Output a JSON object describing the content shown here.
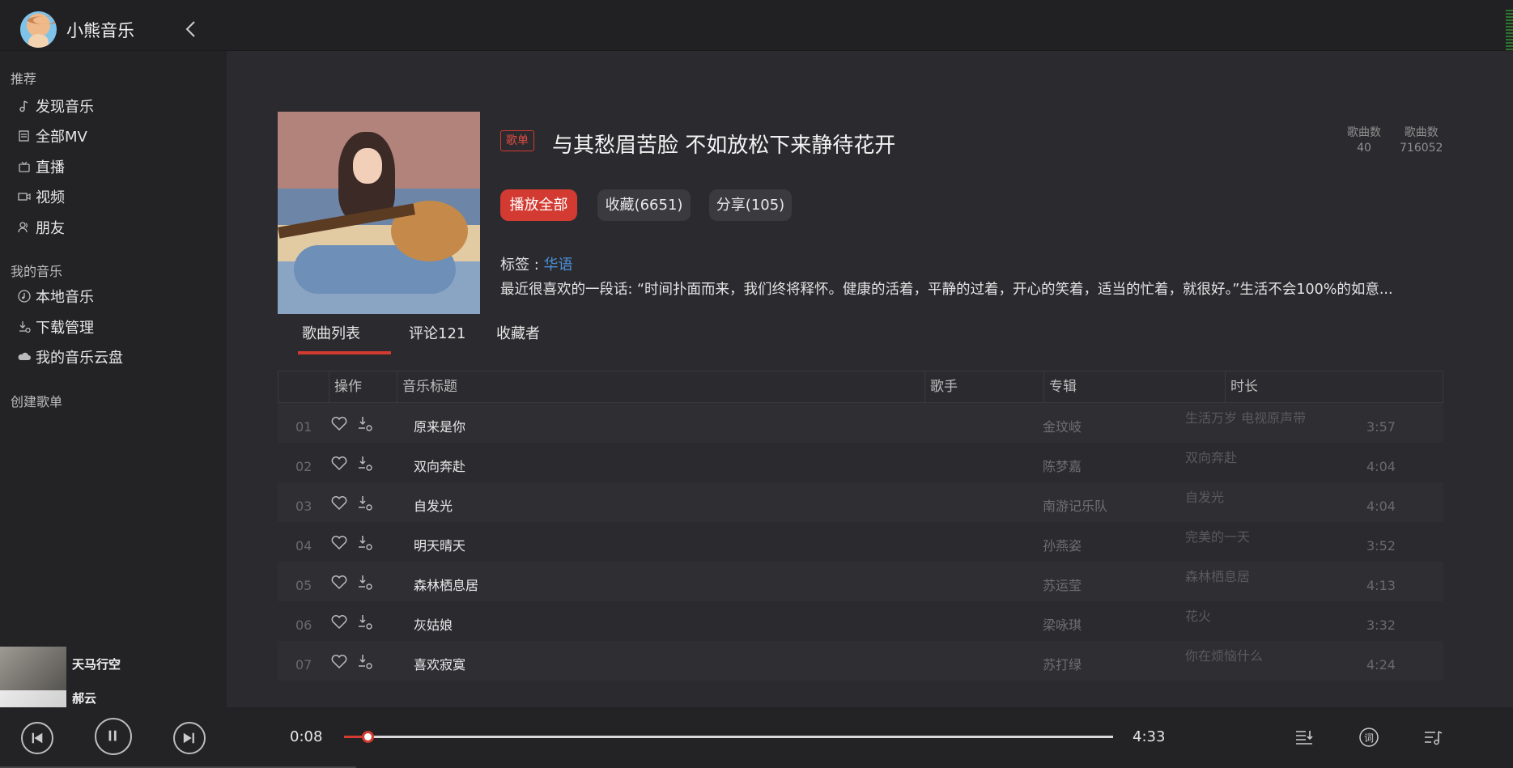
{
  "app": {
    "title": "小熊音乐"
  },
  "sidebar": {
    "section_recommend": "推荐",
    "recommend_items": [
      {
        "label": "发现音乐",
        "icon": "music-note-icon"
      },
      {
        "label": "全部MV",
        "icon": "mv-icon"
      },
      {
        "label": "直播",
        "icon": "live-icon"
      },
      {
        "label": "视频",
        "icon": "video-icon"
      },
      {
        "label": "朋友",
        "icon": "friends-icon"
      }
    ],
    "section_mine": "我的音乐",
    "mine_items": [
      {
        "label": "本地音乐",
        "icon": "local-music-icon"
      },
      {
        "label": "下载管理",
        "icon": "download-icon"
      },
      {
        "label": "我的音乐云盘",
        "icon": "cloud-icon"
      }
    ],
    "section_create": "创建歌单",
    "mini_playlist": [
      {
        "name": "天马行空"
      },
      {
        "name": "郝云"
      }
    ]
  },
  "playlist": {
    "badge": "歌单",
    "title": "与其愁眉苦脸 不如放松下来静待花开",
    "stats": [
      {
        "label": "歌曲数",
        "value": "40"
      },
      {
        "label": "歌曲数",
        "value": "716052"
      }
    ],
    "buttons": {
      "play_all": "播放全部",
      "collect": "收藏(6651)",
      "share": "分享(105)"
    },
    "tag_label": "标签 : ",
    "tag_value": "华语",
    "description": "最近很喜欢的一段话: “时间扑面而来，我们终将释怀。健康的活着，平静的过着，开心的笑着，适当的忙着，就很好。”生活不会100%的如意..."
  },
  "tabs": [
    "歌曲列表",
    "评论121",
    "收藏者"
  ],
  "table": {
    "headers": [
      "操作",
      "音乐标题",
      "歌手",
      "专辑",
      "时长"
    ],
    "rows": [
      {
        "no": "01",
        "title": "原来是你",
        "artist": "金玟岐",
        "album": "生活万岁 电视原声带",
        "duration": "3:57"
      },
      {
        "no": "02",
        "title": "双向奔赴",
        "artist": "陈梦嘉",
        "album": "双向奔赴",
        "duration": "4:04"
      },
      {
        "no": "03",
        "title": "自发光",
        "artist": "南游记乐队",
        "album": "自发光",
        "duration": "4:04"
      },
      {
        "no": "04",
        "title": "明天晴天",
        "artist": "孙燕姿",
        "album": "完美的一天",
        "duration": "3:52"
      },
      {
        "no": "05",
        "title": "森林栖息居",
        "artist": "苏运莹",
        "album": "森林栖息居",
        "duration": "4:13"
      },
      {
        "no": "06",
        "title": "灰姑娘",
        "artist": "梁咏琪",
        "album": "花火",
        "duration": "3:32"
      },
      {
        "no": "07",
        "title": "喜欢寂寞",
        "artist": "苏打绿",
        "album": "你在烦恼什么",
        "duration": "4:24"
      }
    ]
  },
  "player": {
    "current_time": "0:08",
    "total_time": "4:33",
    "progress": 0.03
  },
  "colors": {
    "accent": "#d33a31",
    "link": "#4b8fd8"
  }
}
